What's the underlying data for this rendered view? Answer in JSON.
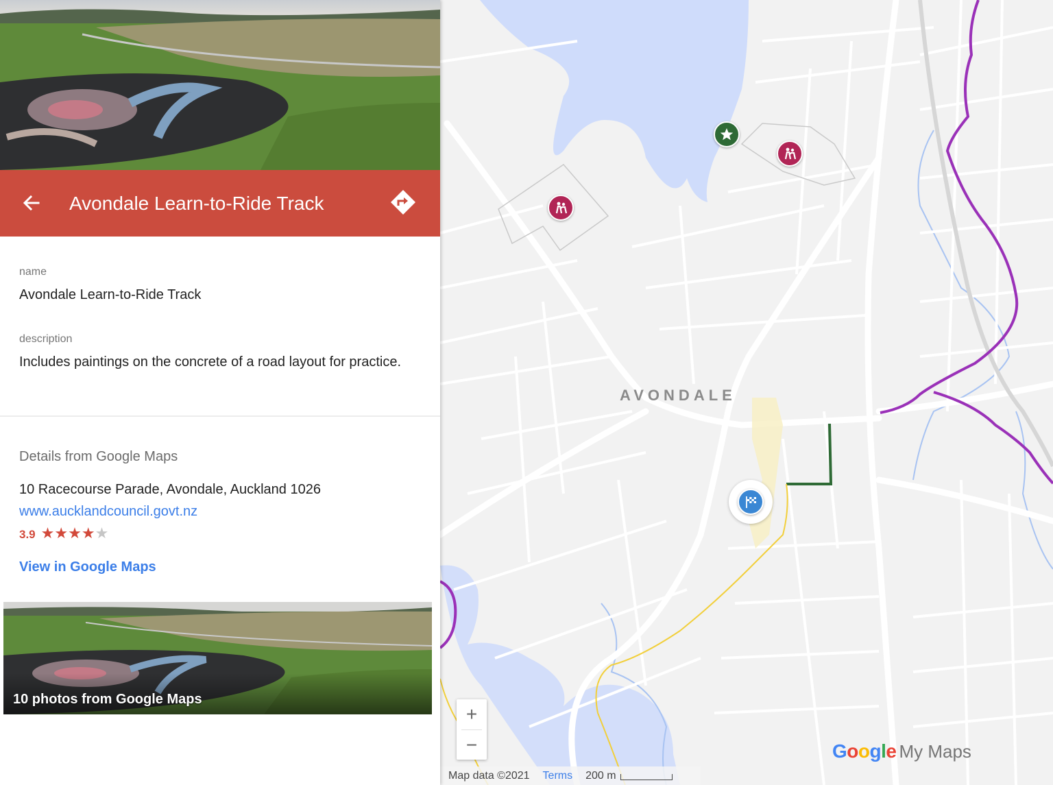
{
  "place": {
    "title": "Avondale Learn-to-Ride Track",
    "name_label": "name",
    "name_value": "Avondale Learn-to-Ride Track",
    "description_label": "description",
    "description_value": "Includes paintings on the concrete of a road layout for practice."
  },
  "details": {
    "heading": "Details from Google Maps",
    "address": "10 Racecourse Parade, Avondale, Auckland 1026",
    "website": "www.aucklandcouncil.govt.nz",
    "rating": "3.9",
    "rating_stars": 3.9,
    "rating_max": 5,
    "view_link": "View in Google Maps",
    "photos_caption": "10 photos from Google Maps"
  },
  "icons": {
    "back": "arrow-left-icon",
    "directions": "directions-icon",
    "poi_star": "star-icon",
    "poi_school": "school-children-icon",
    "poi_flag": "checkered-flag-icon"
  },
  "colors": {
    "header": "#cb4c3e",
    "link": "#3b7ee8",
    "rating": "#d2493a",
    "route_green": "#2e6a35",
    "route_purple": "#9a31b8",
    "route_yellow": "#f2cf3a",
    "water": "#cfdcfb"
  },
  "map": {
    "area_label": "AVONDALE",
    "zoom_in": "+",
    "zoom_out": "−",
    "logo_google": "Google",
    "logo_suffix": "My Maps",
    "attribution": "Map data ©2021",
    "terms": "Terms",
    "scale": "200 m"
  }
}
